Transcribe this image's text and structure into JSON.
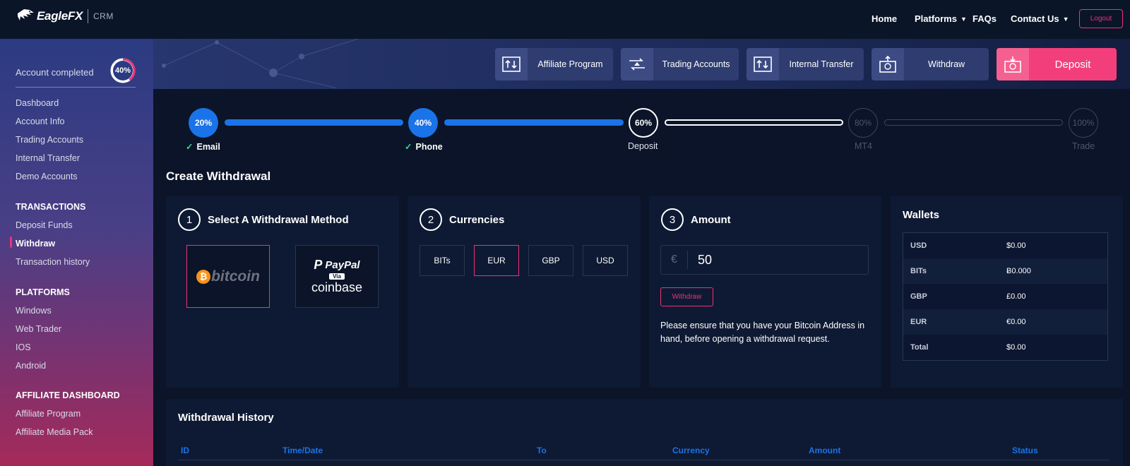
{
  "header": {
    "brand": "EagleFX",
    "sub": "CRM",
    "nav": [
      {
        "label": "Home"
      },
      {
        "label": "Platforms"
      },
      {
        "label": "FAQs"
      },
      {
        "label": "Contact Us"
      }
    ],
    "logout_label": "Logout"
  },
  "sidebar": {
    "account_label": "Account completed",
    "account_percent": "40%",
    "account_fraction": 0.4,
    "links": [
      "Dashboard",
      "Account Info",
      "Trading Accounts",
      "Internal Transfer",
      "Demo Accounts"
    ],
    "transactions_heading": "TRANSACTIONS",
    "transactions": [
      "Deposit Funds",
      "Withdraw",
      "Transaction history"
    ],
    "platforms_heading": "PLATFORMS",
    "platforms": [
      "Windows",
      "Web Trader",
      "IOS",
      "Android"
    ],
    "affiliate_heading": "AFFILIATE DASHBOARD",
    "affiliate": [
      "Affiliate Program",
      "Affiliate Media Pack"
    ]
  },
  "quick_actions": [
    "Affiliate Program",
    "Trading Accounts",
    "Internal Transfer",
    "Withdraw",
    "Deposit"
  ],
  "progress": [
    {
      "percent": "20%",
      "label": "Email"
    },
    {
      "percent": "40%",
      "label": "Phone"
    },
    {
      "percent": "60%",
      "label": "Deposit"
    },
    {
      "percent": "80%",
      "label": "MT4"
    },
    {
      "percent": "100%",
      "label": "Trade"
    }
  ],
  "page_title": "Create Withdrawal",
  "method_card": {
    "number": "1",
    "title": "Select A Withdrawal Method",
    "methods": [
      "bitcoin",
      "PayPal",
      "Via",
      "coinbase"
    ]
  },
  "currency_card": {
    "number": "2",
    "title": "Currencies",
    "options": [
      "BITs",
      "EUR",
      "GBP",
      "USD"
    ],
    "selected": "EUR"
  },
  "amount_card": {
    "number": "3",
    "title": "Amount",
    "symbol": "€",
    "value": "50",
    "button": "Withdraw",
    "note": "Please ensure that you have your Bitcoin Address in hand, before opening a withdrawal request."
  },
  "wallets": {
    "title": "Wallets",
    "rows": [
      {
        "k": "USD",
        "v": "$0.00"
      },
      {
        "k": "BITs",
        "v": "Ƀ0.000"
      },
      {
        "k": "GBP",
        "v": "£0.00"
      },
      {
        "k": "EUR",
        "v": "€0.00"
      },
      {
        "k": "Total",
        "v": "$0.00"
      }
    ]
  },
  "history": {
    "title": "Withdrawal History",
    "columns": [
      "ID",
      "Time/Date",
      "To",
      "Currency",
      "Amount",
      "Status"
    ]
  },
  "colors": {
    "accent": "#f0307a",
    "primary": "#1a73e8",
    "bg": "#0b1428",
    "card": "#0e1a33"
  }
}
